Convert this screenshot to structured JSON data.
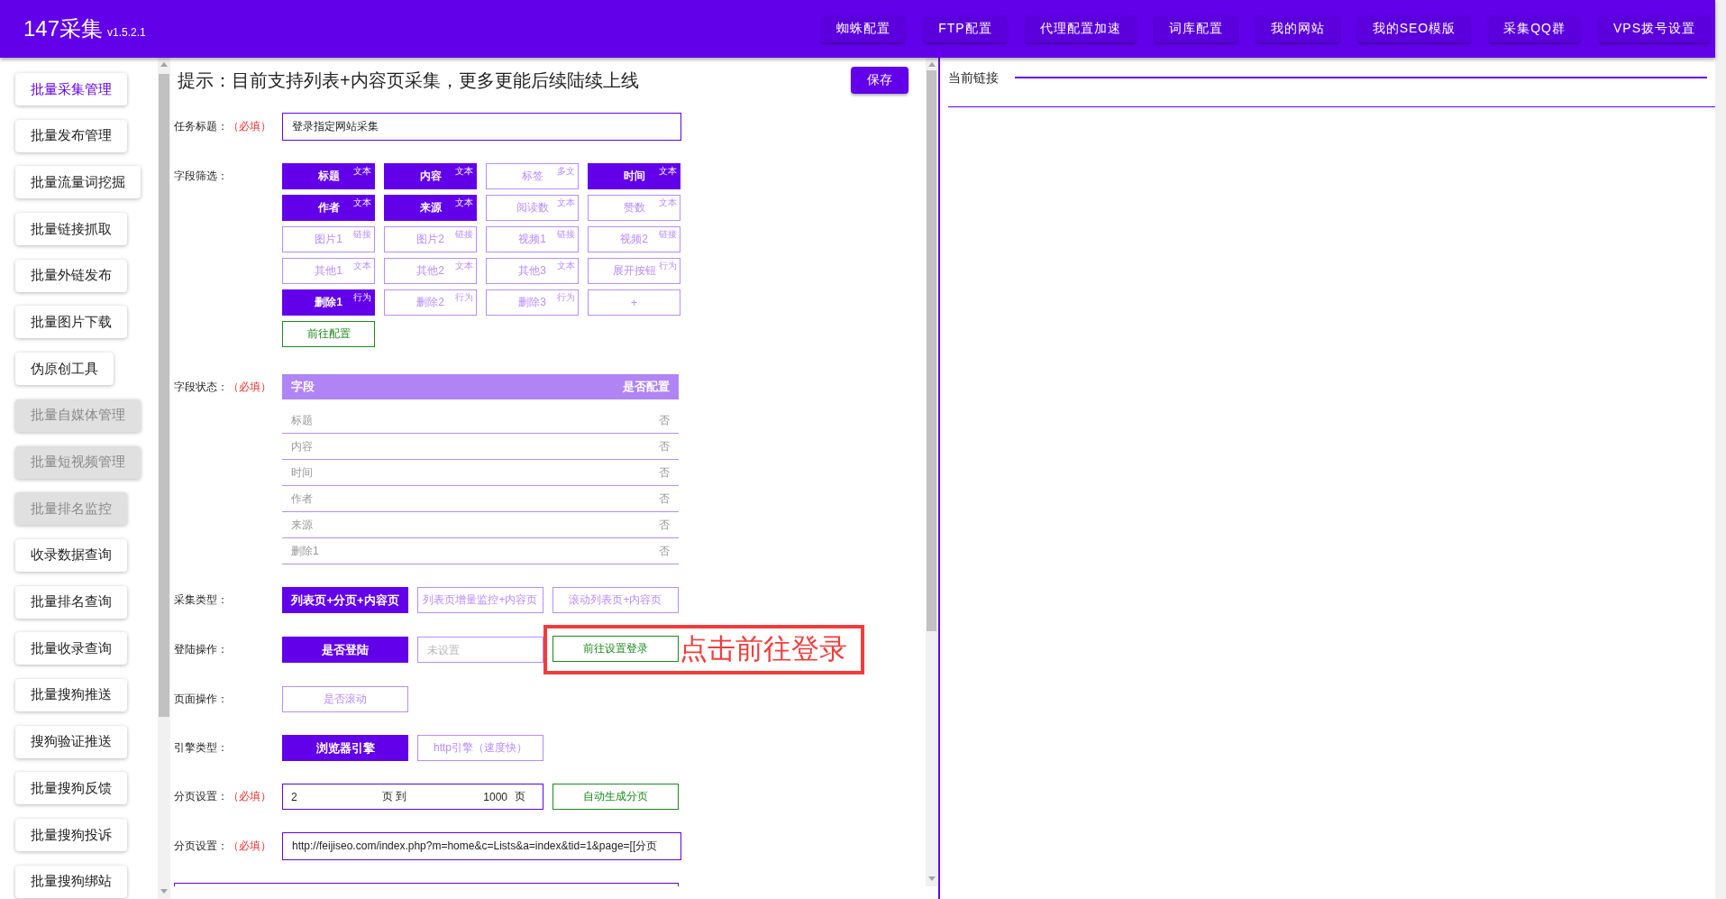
{
  "header": {
    "title": "147采集",
    "version": "v1.5.2.1",
    "nav": [
      "蜘蛛配置",
      "FTP配置",
      "代理配置加速",
      "词库配置",
      "我的网站",
      "我的SEO模版",
      "采集QQ群",
      "VPS拨号设置"
    ]
  },
  "sidebar": {
    "items": [
      {
        "label": "批量采集管理",
        "selected": true,
        "disabled": false
      },
      {
        "label": "批量发布管理",
        "selected": false,
        "disabled": false
      },
      {
        "label": "批量流量词挖掘",
        "selected": false,
        "disabled": false
      },
      {
        "label": "批量链接抓取",
        "selected": false,
        "disabled": false
      },
      {
        "label": "批量外链发布",
        "selected": false,
        "disabled": false
      },
      {
        "label": "批量图片下载",
        "selected": false,
        "disabled": false
      },
      {
        "label": "伪原创工具",
        "selected": false,
        "disabled": false
      },
      {
        "label": "批量自媒体管理",
        "selected": false,
        "disabled": true
      },
      {
        "label": "批量短视频管理",
        "selected": false,
        "disabled": true
      },
      {
        "label": "批量排名监控",
        "selected": false,
        "disabled": true
      },
      {
        "label": "收录数据查询",
        "selected": false,
        "disabled": false
      },
      {
        "label": "批量排名查询",
        "selected": false,
        "disabled": false
      },
      {
        "label": "批量收录查询",
        "selected": false,
        "disabled": false
      },
      {
        "label": "批量搜狗推送",
        "selected": false,
        "disabled": false
      },
      {
        "label": "搜狗验证推送",
        "selected": false,
        "disabled": false
      },
      {
        "label": "批量搜狗反馈",
        "selected": false,
        "disabled": false
      },
      {
        "label": "批量搜狗投诉",
        "selected": false,
        "disabled": false
      },
      {
        "label": "批量搜狗绑站",
        "selected": false,
        "disabled": false
      }
    ]
  },
  "form": {
    "hint": "提示：目前支持列表+内容页采集，更多更能后续陆续上线",
    "save_button": "保存",
    "rows": [
      {
        "kind": "input",
        "label": "任务标题：",
        "required": "（必填）",
        "value": "登录指定网站采集"
      },
      {
        "kind": "field_grid",
        "label": "字段筛选：",
        "fields": [
          {
            "name": "标题",
            "tag": "文本",
            "selected": true
          },
          {
            "name": "内容",
            "tag": "文本",
            "selected": true
          },
          {
            "name": "标签",
            "tag": "多文",
            "selected": false
          },
          {
            "name": "时间",
            "tag": "文本",
            "selected": true
          },
          {
            "name": "作者",
            "tag": "文本",
            "selected": true
          },
          {
            "name": "来源",
            "tag": "文本",
            "selected": true
          },
          {
            "name": "阅读数",
            "tag": "文本",
            "selected": false
          },
          {
            "name": "赞数",
            "tag": "文本",
            "selected": false
          },
          {
            "name": "图片1",
            "tag": "链接",
            "selected": false
          },
          {
            "name": "图片2",
            "tag": "链接",
            "selected": false
          },
          {
            "name": "视频1",
            "tag": "链接",
            "selected": false
          },
          {
            "name": "视频2",
            "tag": "链接",
            "selected": false
          },
          {
            "name": "其他1",
            "tag": "文本",
            "selected": false
          },
          {
            "name": "其他2",
            "tag": "文本",
            "selected": false
          },
          {
            "name": "其他3",
            "tag": "文本",
            "selected": false
          },
          {
            "name": "展开按钮",
            "tag": "行为",
            "selected": false
          },
          {
            "name": "删除1",
            "tag": "行为",
            "selected": true
          },
          {
            "name": "删除2",
            "tag": "行为",
            "selected": false
          },
          {
            "name": "删除3",
            "tag": "行为",
            "selected": false
          },
          {
            "name": "+",
            "selected": false
          }
        ],
        "action": "前往配置"
      },
      {
        "kind": "status_table",
        "label": "字段状态：",
        "required": "（必填）",
        "columns": [
          "字段",
          "是否配置"
        ],
        "rows": [
          [
            "标题",
            "否"
          ],
          [
            "内容",
            "否"
          ],
          [
            "时间",
            "否"
          ],
          [
            "作者",
            "否"
          ],
          [
            "来源",
            "否"
          ],
          [
            "删除1",
            "否"
          ]
        ]
      },
      {
        "kind": "options",
        "label": "采集类型：",
        "options": [
          {
            "label": "列表页+分页+内容页",
            "selected": true
          },
          {
            "label": "列表页增量监控+内容页",
            "selected": false
          },
          {
            "label": "滚动列表页+内容页",
            "selected": false
          }
        ]
      },
      {
        "kind": "login",
        "label": "登陆操作：",
        "options": [
          {
            "label": "是否登陆",
            "selected": true
          }
        ],
        "placeholder": "未设置",
        "action": "前往设置登录",
        "annotation": "点击前往登录"
      },
      {
        "kind": "options",
        "label": "页面操作：",
        "options": [
          {
            "label": "是否滚动",
            "selected": false
          }
        ]
      },
      {
        "kind": "options",
        "label": "引擎类型：",
        "options": [
          {
            "label": "浏览器引擎",
            "selected": true
          },
          {
            "label": "http引擎（速度快）",
            "selected": false
          }
        ]
      },
      {
        "kind": "page_range",
        "label": "分页设置：",
        "required": "（必填）",
        "start": "2",
        "middle": "页 到",
        "end": "1000",
        "unit": "页",
        "action": "自动生成分页"
      },
      {
        "kind": "input",
        "label": "分页设置：",
        "required": "（必填）",
        "value": "http://feijiseo.com/index.php?m=home&c=Lists&a=index&tid=1&page=[[分页"
      },
      {
        "kind": "text_area"
      }
    ]
  },
  "right_panel": {
    "label": "当前链接"
  }
}
